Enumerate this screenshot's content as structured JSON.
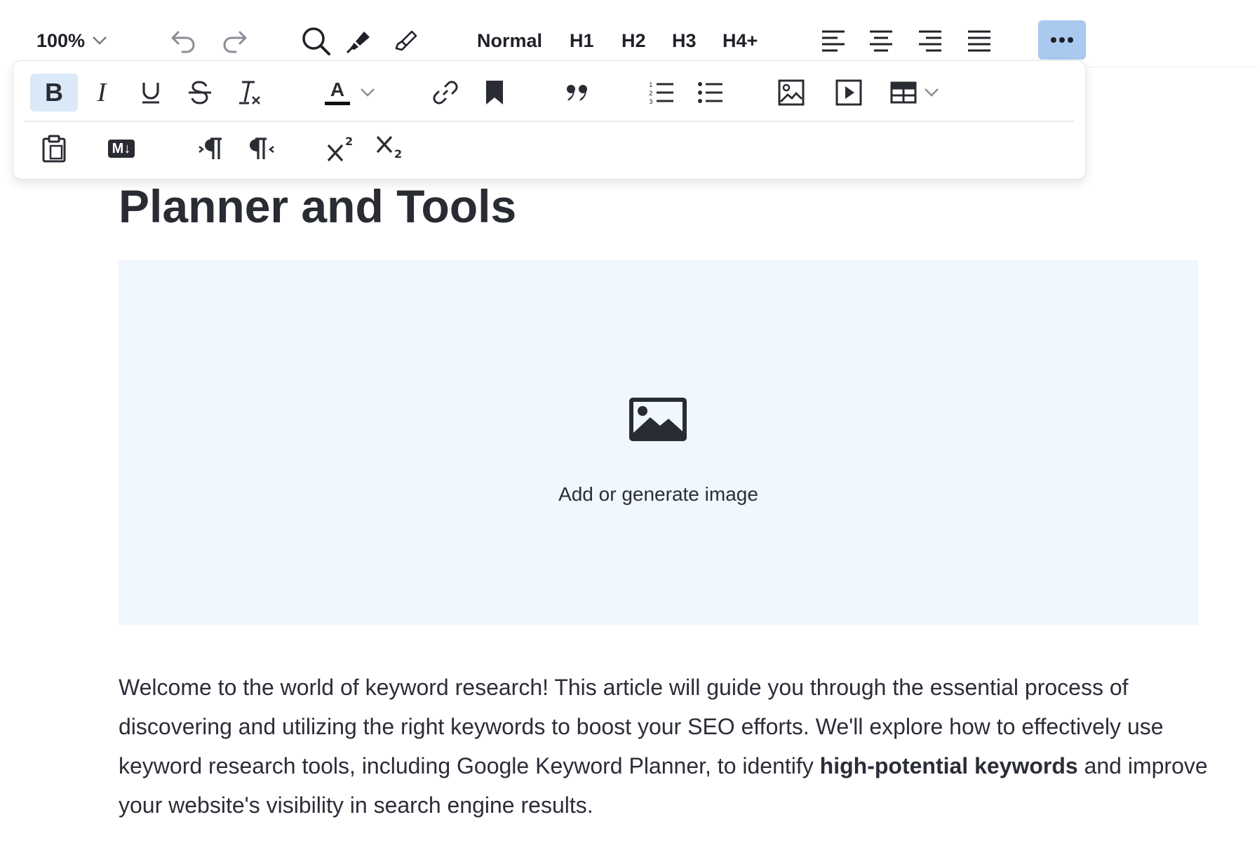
{
  "toolbar": {
    "zoom_label": "100%",
    "headings": [
      "Normal",
      "H1",
      "H2",
      "H3",
      "H4+"
    ],
    "icons": [
      "undo-icon",
      "redo-icon",
      "search-icon",
      "highlighter-icon",
      "brush-icon",
      "align-left-icon",
      "align-center-icon",
      "align-right-icon",
      "align-justify-icon",
      "more-icon"
    ],
    "more_button_color": "#a9c9ef"
  },
  "format_panel": {
    "row1_icons": [
      "bold-icon",
      "italic-icon",
      "underline-icon",
      "strikethrough-icon",
      "clear-format-icon",
      "text-color-icon",
      "link-icon",
      "bookmark-icon",
      "quote-icon",
      "numbered-list-icon",
      "bulleted-list-icon",
      "image-icon",
      "video-icon",
      "table-icon"
    ],
    "row2_icons": [
      "paste-icon",
      "markdown-icon",
      "ltr-paragraph-icon",
      "rtl-paragraph-icon",
      "superscript-icon",
      "subscript-icon"
    ],
    "bold_label": "B",
    "italic_label": "I",
    "text_color_label": "A",
    "markdown_label": "M↓",
    "active_color": "#dbe8f8"
  },
  "document": {
    "title": "Planner and Tools",
    "image_placeholder_label": "Add or generate image",
    "intro": {
      "before": "Welcome to the world of keyword research! This article will guide you through the essential process of discovering and utilizing the right keywords to boost your SEO efforts. We'll explore how to effectively use keyword research tools, including Google Keyword Planner, to identify ",
      "bold": "high-potential keywords",
      "after": " and improve your website's visibility in search engine results."
    }
  }
}
